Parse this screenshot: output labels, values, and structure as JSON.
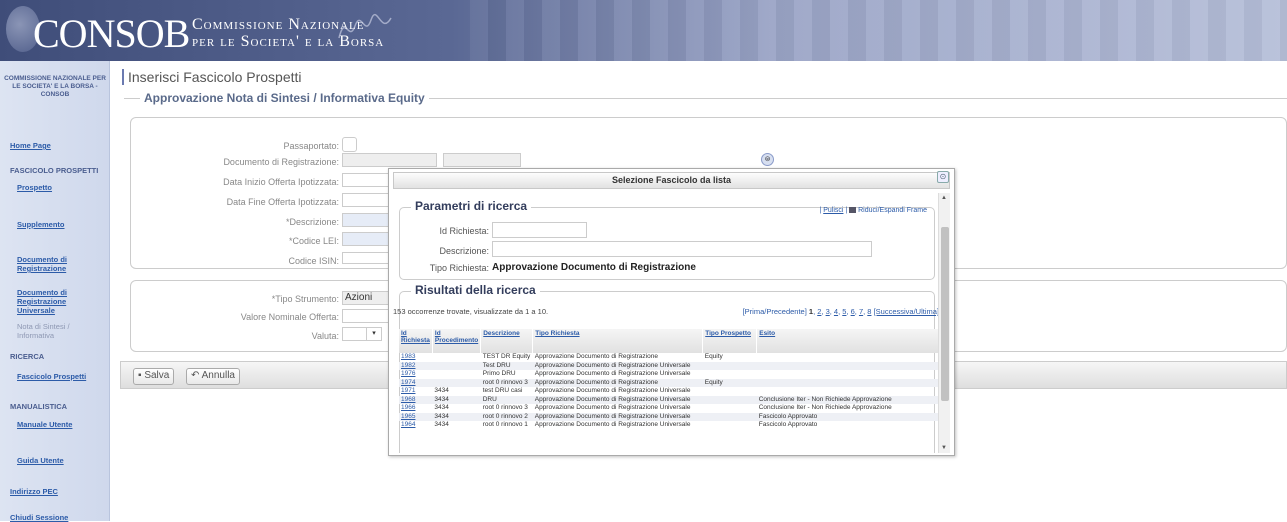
{
  "header": {
    "logo_main": "CONSOB",
    "logo_line1": "Commissione Nazionale",
    "logo_line2": "per le Societa' e la Borsa"
  },
  "sidebar": {
    "org": "COMMISSIONE NAZIONALE PER LE SOCIETA' E LA BORSA - CONSOB",
    "items": [
      {
        "label": "Home Page"
      },
      {
        "label": "FASCICOLO PROSPETTI"
      },
      {
        "label": "Prospetto"
      },
      {
        "label": "Supplemento"
      },
      {
        "label": "Documento di Registrazione"
      },
      {
        "label": "Documento di Registrazione Universale"
      },
      {
        "label": "Nota di Sintesi / Informativa"
      },
      {
        "label": "RICERCA"
      },
      {
        "label": "Fascicolo Prospetti"
      },
      {
        "label": "MANUALISTICA"
      },
      {
        "label": "Manuale Utente"
      },
      {
        "label": "Guida Utente"
      },
      {
        "label": "Indirizzo PEC"
      },
      {
        "label": "Chiudi Sessione"
      }
    ]
  },
  "main": {
    "title": "Inserisci Fascicolo Prospetti",
    "section_title": "Approvazione Nota di Sintesi / Informativa Equity",
    "labels": {
      "passaportato": "Passaportato:",
      "documento": "Documento di Registrazione:",
      "data_inizio": "Data Inizio Offerta Ipotizzata:",
      "data_fine": "Data Fine Offerta Ipotizzata:",
      "descrizione": "*Descrizione:",
      "codice_lei": "*Codice LEI:",
      "codice_isin": "Codice ISIN:",
      "tipo_strumento": "*Tipo Strumento:",
      "valore_nominale": "Valore Nominale Offerta:",
      "valuta": "Valuta:"
    },
    "tipo_strumento_value": "Azioni",
    "buttons": {
      "save": "Salva",
      "cancel": "Annulla"
    }
  },
  "dialog": {
    "title": "Selezione Fascicolo da lista",
    "params_legend": "Parametri di ricerca",
    "pulisci": "Pulisci",
    "riduci": "Riduci/Espandi Frame",
    "id_label": "Id Richiesta:",
    "descr_label": "Descrizione:",
    "tipo_label": "Tipo Richiesta:",
    "tipo_value": "Approvazione Documento di Registrazione",
    "results_legend": "Risultati della ricerca",
    "count_text": "153 occorrenze trovate, visualizzate da 1 a 10.",
    "pager": {
      "prima": "[Prima/Precedente]",
      "current": "1",
      "pages": [
        "2",
        "3",
        "4",
        "5",
        "6",
        "7",
        "8"
      ],
      "successiva": "[Successiva/Ultima]"
    },
    "columns": [
      "Id Richiesta",
      "Id Procedimento",
      "Descrizione",
      "Tipo Richiesta",
      "Tipo Prospetto",
      "Esito"
    ],
    "rows": [
      {
        "id": "1983",
        "proc": "",
        "descr": "TEST DR Equity",
        "tipo": "Approvazione Documento di Registrazione",
        "prosp": "Equity",
        "esito": ""
      },
      {
        "id": "1982",
        "proc": "",
        "descr": "Test DRU",
        "tipo": "Approvazione Documento di Registrazione Universale",
        "prosp": "",
        "esito": ""
      },
      {
        "id": "1976",
        "proc": "",
        "descr": "Primo DRU",
        "tipo": "Approvazione Documento di Registrazione Universale",
        "prosp": "",
        "esito": ""
      },
      {
        "id": "1974",
        "proc": "",
        "descr": "root 0 rinnovo 3",
        "tipo": "Approvazione Documento di Registrazione",
        "prosp": "Equity",
        "esito": ""
      },
      {
        "id": "1971",
        "proc": "3434",
        "descr": "test DRU casi",
        "tipo": "Approvazione Documento di Registrazione Universale",
        "prosp": "",
        "esito": ""
      },
      {
        "id": "1968",
        "proc": "3434",
        "descr": "DRU",
        "tipo": "Approvazione Documento di Registrazione Universale",
        "prosp": "",
        "esito": "Conclusione Iter - Non Richiede Approvazione"
      },
      {
        "id": "1966",
        "proc": "3434",
        "descr": "root 0 rinnovo 3",
        "tipo": "Approvazione Documento di Registrazione Universale",
        "prosp": "",
        "esito": "Conclusione Iter - Non Richiede Approvazione"
      },
      {
        "id": "1965",
        "proc": "3434",
        "descr": "root 0 rinnovo 2",
        "tipo": "Approvazione Documento di Registrazione Universale",
        "prosp": "",
        "esito": "Fascicolo Approvato"
      },
      {
        "id": "1964",
        "proc": "3434",
        "descr": "root 0 rinnovo 1",
        "tipo": "Approvazione Documento di Registrazione Universale",
        "prosp": "",
        "esito": "Fascicolo Approvato"
      }
    ]
  }
}
